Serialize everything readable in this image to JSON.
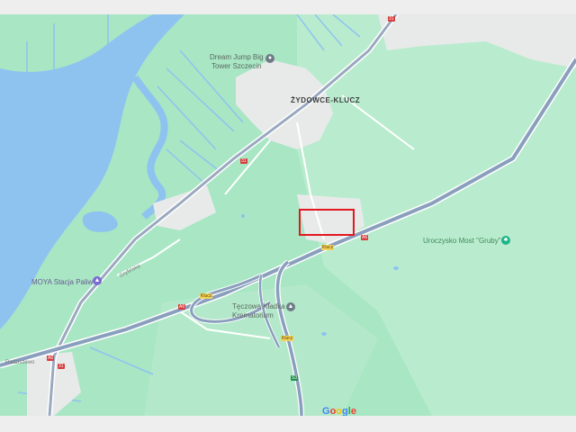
{
  "map": {
    "labels": {
      "settlement": "ŻYDOWCE-KLUCZ",
      "poi_dream_jump": "Dream Jump Big\nTower Szczecin",
      "poi_moya": "MOYA Stacja Paliw",
      "poi_crematorium": "Tęczowa Kładka\nKrematorium",
      "park": "Uroczysko Most \"Gruby\"",
      "street_gryfino": "Gryfińska",
      "street_radziszewo": "Radziszewo"
    },
    "shields": {
      "r31_top": "31",
      "r31_mid": "31",
      "r31_bottom": "31",
      "a6_a": "A6",
      "a6_b": "A6",
      "a6_c": "A6",
      "klucz_1": "Klucz",
      "klucz_2": "Klucz",
      "klucz_3": "Klucz",
      "s3": "S3"
    },
    "logo": {
      "letters": [
        "G",
        "o",
        "o",
        "g",
        "l",
        "e"
      ],
      "colors": [
        "#4285f4",
        "#ea4335",
        "#fbbc05",
        "#4285f4",
        "#34a853",
        "#ea4335"
      ]
    },
    "colors": {
      "water": "#8ec3f0",
      "land": "#a8e6c4",
      "urban": "#e8eaea",
      "motorway": "#8a9fbd",
      "highlight": "#e3171f",
      "park_pin": "#1fb48a",
      "shop_pin": "#7a6bd0",
      "generic_pin": "#6e7b86"
    }
  }
}
